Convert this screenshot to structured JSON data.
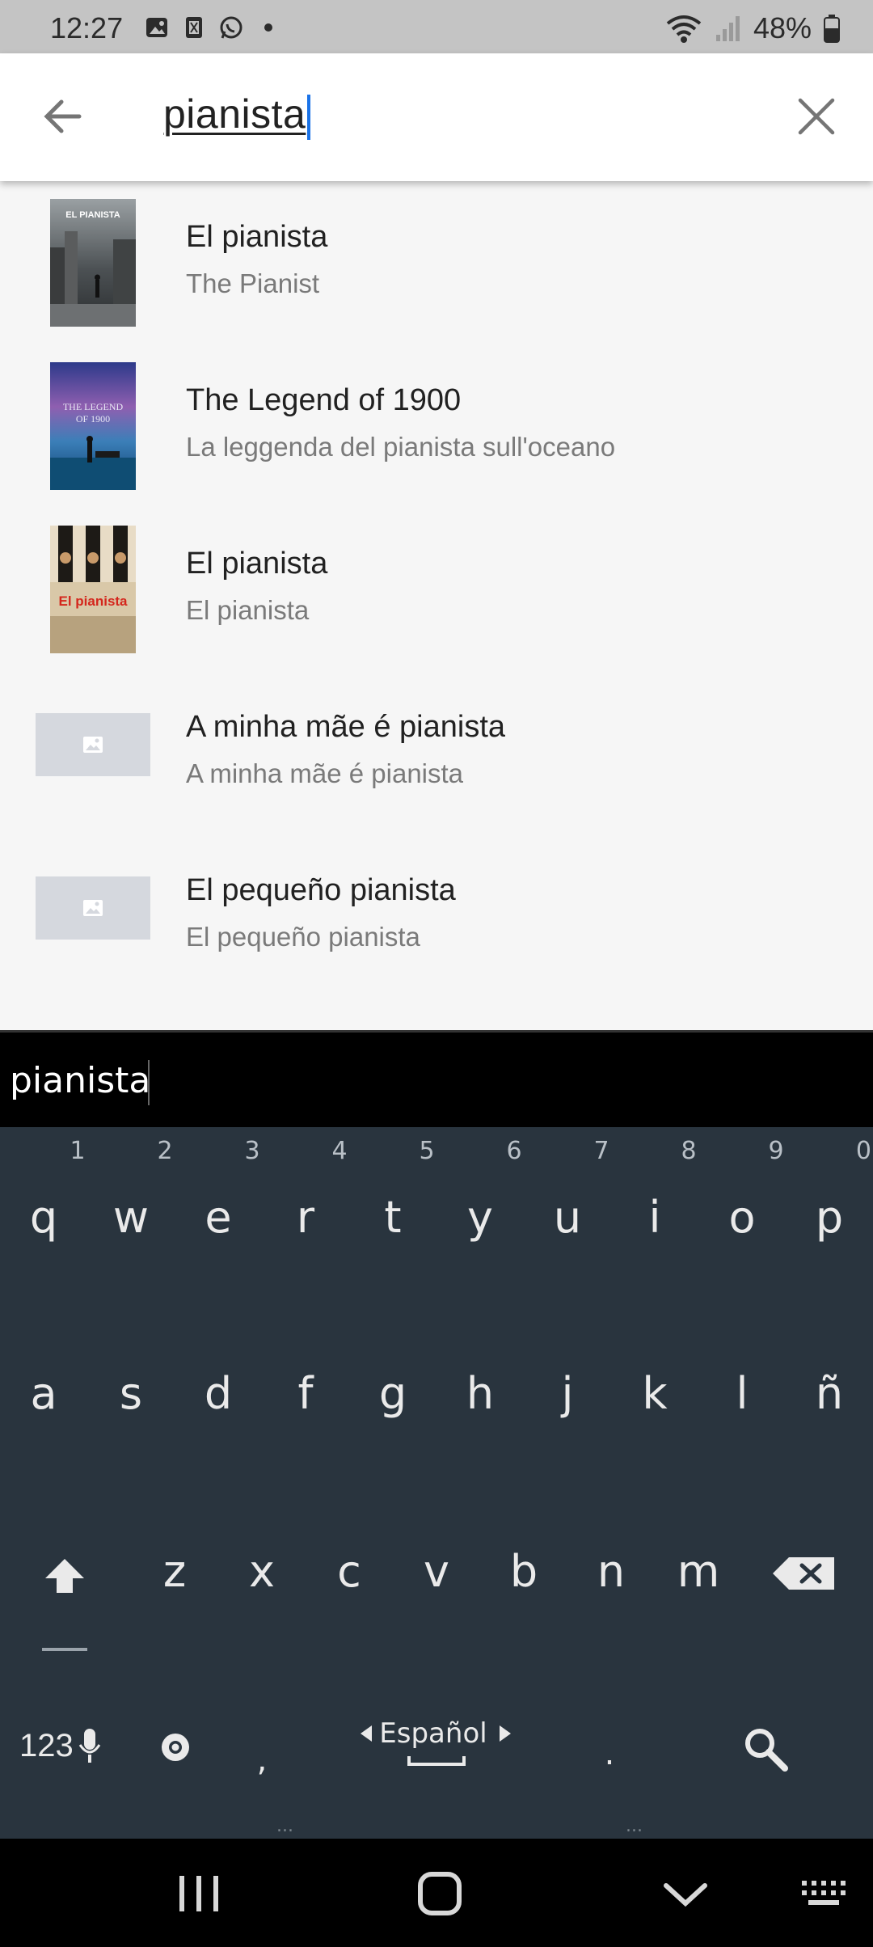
{
  "status_bar": {
    "time": "12:27",
    "battery": "48%"
  },
  "search": {
    "query": "pianista"
  },
  "results": [
    {
      "title": "El pianista",
      "subtitle": "The Pianist",
      "poster_text": "EL PIANISTA"
    },
    {
      "title": "The Legend of 1900",
      "subtitle": "La leggenda del pianista sull'oceano",
      "poster_text": "THE LEGEND OF 1900"
    },
    {
      "title": "El pianista",
      "subtitle": "El pianista",
      "poster_text": "El pianista"
    },
    {
      "title": "A minha mãe é pianista",
      "subtitle": "A minha mãe é pianista"
    },
    {
      "title": "El pequeño pianista",
      "subtitle": "El pequeño pianista"
    }
  ],
  "keyboard": {
    "suggestion": "pianista",
    "numbers": [
      "1",
      "2",
      "3",
      "4",
      "5",
      "6",
      "7",
      "8",
      "9",
      "0"
    ],
    "row1": [
      "q",
      "w",
      "e",
      "r",
      "t",
      "y",
      "u",
      "i",
      "o",
      "p"
    ],
    "row2": [
      "a",
      "s",
      "d",
      "f",
      "g",
      "h",
      "j",
      "k",
      "l",
      "ñ"
    ],
    "row3": [
      "z",
      "x",
      "c",
      "v",
      "b",
      "n",
      "m"
    ],
    "mode_key": "123",
    "comma": ",",
    "period": ".",
    "language": "Español",
    "dots": "..."
  }
}
